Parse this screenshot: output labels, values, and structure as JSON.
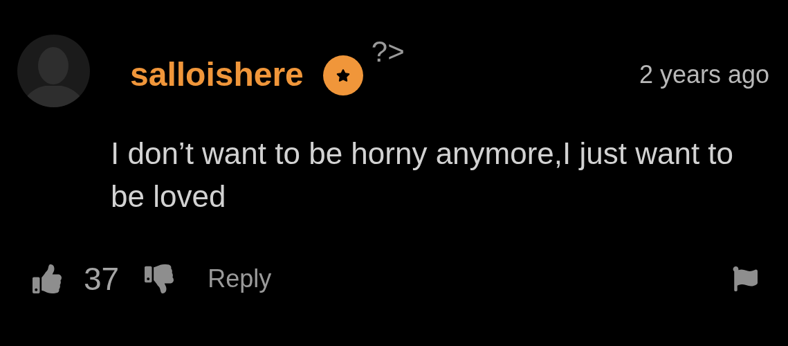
{
  "comment": {
    "username": "salloishere",
    "code_fragment": "?>",
    "time": "2 years ago",
    "text": "I don’t want to be horny anymore,I just want to be loved",
    "likes": "37",
    "reply": "Reply"
  }
}
